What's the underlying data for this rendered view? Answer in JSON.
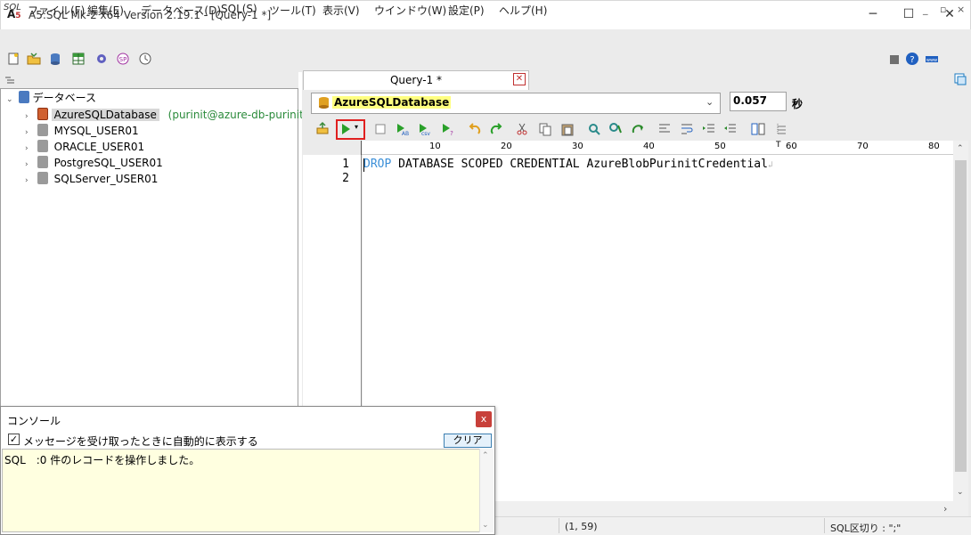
{
  "window": {
    "title": "A5:SQL Mk-2 x64 Version 2.19.1 - [Query-1 *]",
    "minimize": "─",
    "maximize": "☐",
    "close": "✕"
  },
  "menu": {
    "items": [
      "ファイル(F)",
      "編集(E)",
      "データベース(D)",
      "SQL(S)",
      "ツール(T)",
      "表示(V)",
      "ウインドウ(W)",
      "設定(P)",
      "ヘルプ(H)"
    ]
  },
  "tree": {
    "root_label": "データベース",
    "items": [
      {
        "label": "AzureSQLDatabase",
        "sub": "(purinit@azure-db-purinit)",
        "selected": true
      },
      {
        "label": "MYSQL_USER01",
        "sub": "",
        "selected": false
      },
      {
        "label": "ORACLE_USER01",
        "sub": "",
        "selected": false
      },
      {
        "label": "PostgreSQL_USER01",
        "sub": "",
        "selected": false
      },
      {
        "label": "SQLServer_USER01",
        "sub": "",
        "selected": false
      }
    ]
  },
  "editor": {
    "tab_label": "Query-1 *",
    "connection": "AzureSQLDatabase",
    "elapsed": "0.057",
    "elapsed_unit": "秒",
    "ruler": [
      "10",
      "20",
      "30",
      "40",
      "50",
      "60",
      "70",
      "80"
    ],
    "line_numbers": [
      "1",
      "2"
    ],
    "code_keyword": "DROP",
    "code_rest": " DATABASE SCOPED CREDENTIAL AzureBlobPurinitCredential"
  },
  "console": {
    "title": "コンソール",
    "auto_show_label": "メッセージを受け取ったときに自動的に表示する",
    "auto_show_checked": true,
    "clear_label": "クリア",
    "close_label": "x",
    "log": "SQL　:0 件のレコードを操作しました。"
  },
  "status": {
    "cursor": "(1, 59)",
    "delimiter": "SQL区切り : \";\""
  },
  "colors": {
    "accent": "#e02020",
    "keyword": "#3b8fd8",
    "highlight": "#ffff80",
    "console_bg": "#ffffe0"
  }
}
